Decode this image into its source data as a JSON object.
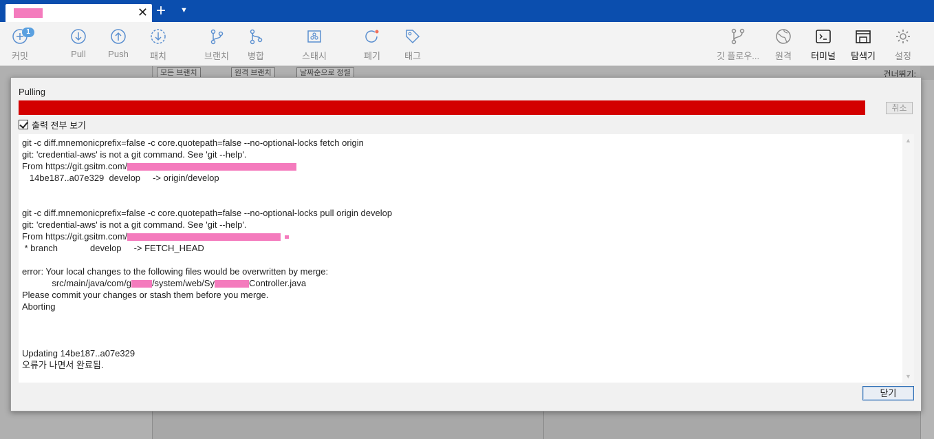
{
  "tabbar": {
    "add_icon": "plus-icon",
    "menu_icon": "chevron-down-icon",
    "close_glyph": "✕",
    "add_glyph": "+",
    "menu_glyph": "▼"
  },
  "toolbar": {
    "commit": {
      "label": "커밋",
      "badge": "1",
      "icon": "commit-plus-icon"
    },
    "pull": {
      "label": "Pull",
      "icon": "arrow-down-circle-icon"
    },
    "push": {
      "label": "Push",
      "icon": "arrow-up-circle-icon"
    },
    "fetch": {
      "label": "패치",
      "icon": "fetch-icon"
    },
    "branch": {
      "label": "브랜치",
      "icon": "branch-icon"
    },
    "merge": {
      "label": "병합",
      "icon": "merge-icon"
    },
    "stash": {
      "label": "스태시",
      "icon": "stash-icon"
    },
    "discard": {
      "label": "폐기",
      "icon": "discard-icon"
    },
    "tag": {
      "label": "태그",
      "icon": "tag-icon"
    },
    "gitflow": {
      "label": "깃 플로우...",
      "icon": "gitflow-icon"
    },
    "remote": {
      "label": "원격",
      "icon": "globe-icon"
    },
    "terminal": {
      "label": "터미널",
      "icon": "terminal-icon"
    },
    "explorer": {
      "label": "탐색기",
      "icon": "folder-icon"
    },
    "settings": {
      "label": "설정",
      "icon": "gear-icon"
    }
  },
  "background": {
    "branch_filter": "모든 브랜치",
    "remote_branch": "원격 브랜치",
    "sort": "날짜순으로 정렬",
    "right_label": "건너뛰기:"
  },
  "dialog": {
    "title": "Pulling",
    "progress_fraction": 1.0,
    "progress_color": "#d30000",
    "cancel_label": "취소",
    "show_full_output_label": "출력 전부 보기",
    "show_full_output_checked": true,
    "close_label": "닫기",
    "output_lines": [
      "git -c diff.mnemonicprefix=false -c core.quotepath=false --no-optional-locks fetch origin",
      "git: 'credential-aws' is not a git command. See 'git --help'.",
      "From https://git.gsitm.com/",
      "   14be187..a07e329  develop     -> origin/develop",
      "",
      "",
      "git -c diff.mnemonicprefix=false -c core.quotepath=false --no-optional-locks pull origin develop",
      "git: 'credential-aws' is not a git command. See 'git --help'.",
      "From https://git.gsitm.com/",
      " * branch             develop     -> FETCH_HEAD",
      "",
      "error: Your local changes to the following files would be overwritten by merge:",
      "            src/main/java/com/g",
      "Please commit your changes or stash them before you merge.",
      "Aborting",
      "",
      "",
      "",
      "Updating 14be187..a07e329",
      "오류가 나면서 완료됨."
    ],
    "redacted_path_mid": "/system/web/Sy",
    "redacted_path_end": "Controller.java"
  }
}
